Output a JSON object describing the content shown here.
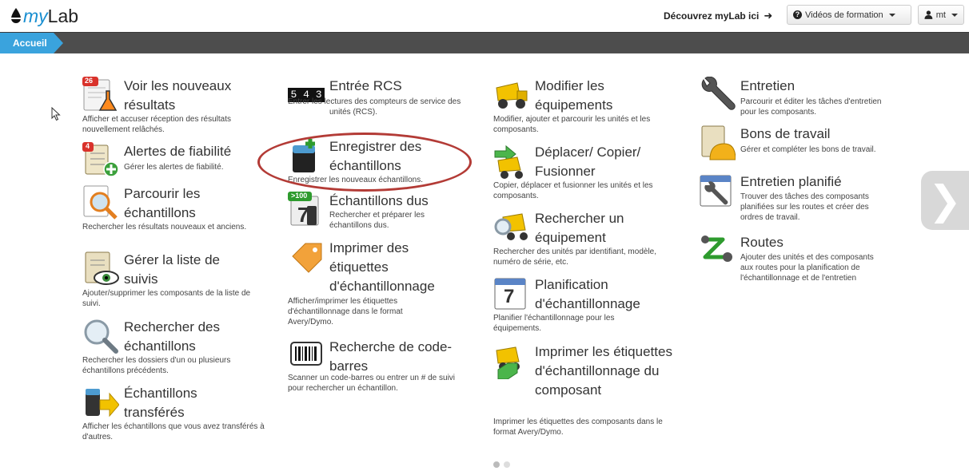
{
  "header": {
    "logo_my": "my",
    "logo_lab": "Lab",
    "discover": "Découvrez myLab ici",
    "videos_button": "Vidéos de formation",
    "user_button": "mt"
  },
  "breadcrumb": {
    "home": "Accueil"
  },
  "tiles": {
    "voir_resultats": {
      "badge": "26",
      "title": "Voir les nouveaux résultats",
      "desc": "Afficher et accuser réception des résultats nouvellement relâchés."
    },
    "alertes": {
      "badge": "4",
      "title": "Alertes de fiabilité",
      "desc": "Gérer les alertes de fiabilité."
    },
    "parcourir": {
      "title": "Parcourir les échantillons",
      "desc": "Rechercher les résultats nouveaux et anciens."
    },
    "gerer_suivis": {
      "title": "Gérer la liste de suivis",
      "desc": "Ajouter/supprimer les composants de la liste de suivi."
    },
    "rechercher_echantillons": {
      "title": "Rechercher des échantillons",
      "desc": "Rechercher les dossiers d'un ou plusieurs échantillons précédents."
    },
    "transferes": {
      "title": "Échantillons transférés",
      "desc": "Afficher les échantillons que vous avez transférés à d'autres."
    },
    "entree_rcs": {
      "counter": "5 4 3",
      "title": "Entrée RCS",
      "desc": "Entrer les lectures des compteurs de service des unités (RCS)."
    },
    "enregistrer": {
      "title": "Enregistrer des échantillons",
      "desc": "Enregistrer les nouveaux échantillons."
    },
    "dus": {
      "badge": ">100",
      "title": "Échantillons dus",
      "desc": "Rechercher et préparer les échantillons dus."
    },
    "imprimer_etiquettes": {
      "title": "Imprimer des étiquettes d'échantillonnage",
      "desc": "Afficher/imprimer les étiquettes d'échantillonnage dans le format Avery/Dymo."
    },
    "code_barres": {
      "title": "Recherche de code-barres",
      "desc": "Scanner un code-barres ou entrer un # de suivi pour rechercher un échantillon."
    },
    "modifier_equip": {
      "title": "Modifier les équipements",
      "desc": "Modifier, ajouter et parcourir les unités et les composants."
    },
    "deplacer": {
      "title": "Déplacer/ Copier/ Fusionner",
      "desc": "Copier, déplacer et fusionner les unités et les composants."
    },
    "rechercher_equip": {
      "title": "Rechercher un équipement",
      "desc": "Rechercher des unités par identifiant, modèle, numéro de série, etc."
    },
    "planification": {
      "cal_num": "7",
      "title": "Planification d'échantillonnage",
      "desc": "Planifier l'échantillonnage pour les équipements."
    },
    "imprimer_composant": {
      "title": "Imprimer les étiquettes d'échantillonnage du composant",
      "desc": "Imprimer les étiquettes des composants dans le format Avery/Dymo."
    },
    "entretien": {
      "title": "Entretien",
      "desc": "Parcourir et éditer les tâches d'entretien pour les composants."
    },
    "bons_travail": {
      "title": "Bons de travail",
      "desc": "Gérer et compléter les bons de travail."
    },
    "entretien_planifie": {
      "title": "Entretien planifié",
      "desc": "Trouver des tâches des composants planifiées sur les routes et créer des ordres de travail."
    },
    "routes": {
      "title": "Routes",
      "desc": "Ajouter des unités et des composants aux routes pour la planification de l'échantillonnage et de l'entretien"
    }
  },
  "pager": {
    "pages": 2,
    "current": 1
  },
  "colors": {
    "accent": "#3aa3dd",
    "navbar": "#4d4d4d",
    "highlight": "#b33b36"
  }
}
